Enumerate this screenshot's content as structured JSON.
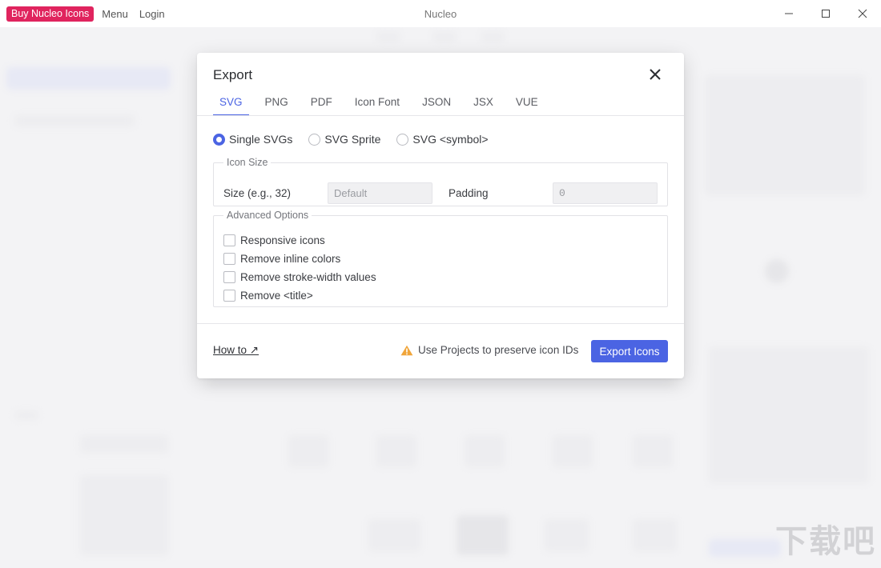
{
  "titlebar": {
    "buy_label": "Buy Nucleo Icons",
    "menu_label": "Menu",
    "login_label": "Login",
    "app_title": "Nucleo",
    "controls": [
      "minimize-icon",
      "maximize-icon",
      "close-icon"
    ]
  },
  "modal": {
    "title": "Export",
    "tabs": [
      {
        "label": "SVG",
        "active": true
      },
      {
        "label": "PNG"
      },
      {
        "label": "PDF"
      },
      {
        "label": "Icon Font"
      },
      {
        "label": "JSON"
      },
      {
        "label": "JSX"
      },
      {
        "label": "VUE"
      }
    ],
    "formats": [
      {
        "label": "Single SVGs",
        "checked": true
      },
      {
        "label": "SVG Sprite",
        "checked": false
      },
      {
        "label": "SVG <symbol>",
        "checked": false
      }
    ],
    "icon_size": {
      "legend": "Icon Size",
      "size_label": "Size (e.g., 32)",
      "size_placeholder": "Default",
      "padding_label": "Padding",
      "padding_placeholder": "0"
    },
    "advanced": {
      "legend": "Advanced Options",
      "options": [
        {
          "label": "Responsive icons",
          "checked": false
        },
        {
          "label": "Remove inline colors",
          "checked": false
        },
        {
          "label": "Remove stroke-width values",
          "checked": false
        },
        {
          "label": "Remove <title>",
          "checked": false
        }
      ]
    },
    "footer": {
      "howto_label": "How to ↗",
      "hint": "Use Projects to preserve icon IDs",
      "export_label": "Export Icons"
    }
  },
  "colors": {
    "accent": "#4b64e3",
    "brand": "#e0245e",
    "warning": "#f0a53a"
  },
  "watermark": "下载吧"
}
